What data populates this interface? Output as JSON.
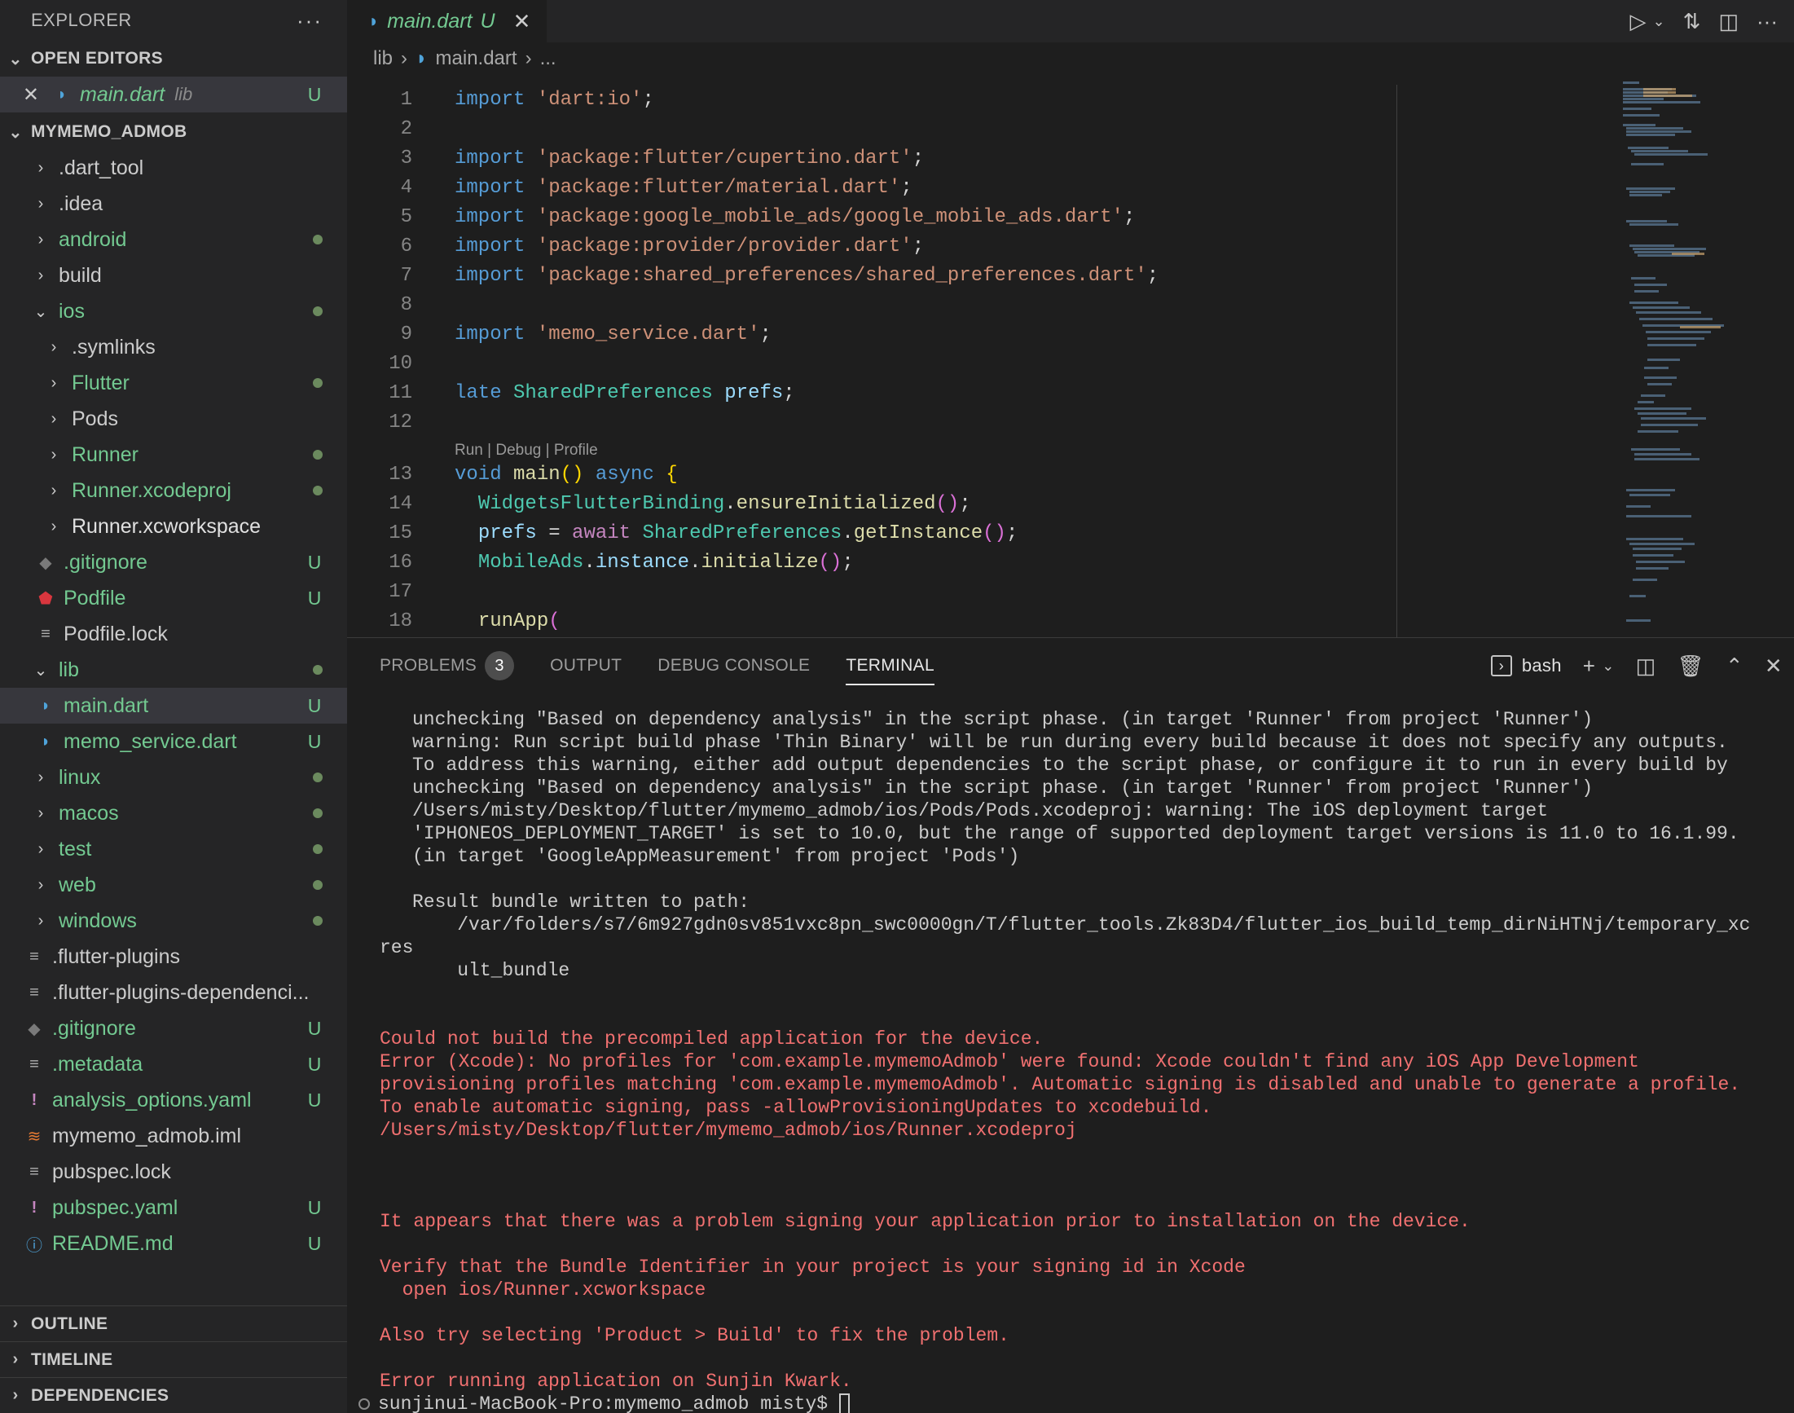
{
  "sidebar": {
    "title": "EXPLORER",
    "open_editors": {
      "label": "OPEN EDITORS",
      "items": [
        {
          "name": "main.dart",
          "folder": "lib",
          "badge": "U"
        }
      ]
    },
    "project": {
      "label": "MYMEMO_ADMOB",
      "items": [
        {
          "label": ".dart_tool"
        },
        {
          "label": ".idea"
        },
        {
          "label": "android"
        },
        {
          "label": "build"
        },
        {
          "label": "ios"
        },
        {
          "label": ".symlinks"
        },
        {
          "label": "Flutter"
        },
        {
          "label": "Pods"
        },
        {
          "label": "Runner"
        },
        {
          "label": "Runner.xcodeproj"
        },
        {
          "label": "Runner.xcworkspace"
        },
        {
          "label": ".gitignore",
          "badge": "U"
        },
        {
          "label": "Podfile",
          "badge": "U"
        },
        {
          "label": "Podfile.lock"
        },
        {
          "label": "lib"
        },
        {
          "label": "main.dart",
          "badge": "U"
        },
        {
          "label": "memo_service.dart",
          "badge": "U"
        },
        {
          "label": "linux"
        },
        {
          "label": "macos"
        },
        {
          "label": "test"
        },
        {
          "label": "web"
        },
        {
          "label": "windows"
        },
        {
          "label": ".flutter-plugins"
        },
        {
          "label": ".flutter-plugins-dependenci..."
        },
        {
          "label": ".gitignore",
          "badge": "U"
        },
        {
          "label": ".metadata",
          "badge": "U"
        },
        {
          "label": "analysis_options.yaml",
          "badge": "U"
        },
        {
          "label": "mymemo_admob.iml"
        },
        {
          "label": "pubspec.lock"
        },
        {
          "label": "pubspec.yaml",
          "badge": "U"
        },
        {
          "label": "README.md",
          "badge": "U"
        }
      ]
    },
    "outline": "OUTLINE",
    "timeline": "TIMELINE",
    "dependencies": "DEPENDENCIES"
  },
  "editor": {
    "tab": {
      "name": "main.dart",
      "badge": "U"
    },
    "breadcrumb": {
      "folder": "lib",
      "file": "main.dart",
      "more": "..."
    },
    "codelens": "Run | Debug | Profile",
    "line_numbers": [
      "1",
      "2",
      "3",
      "4",
      "5",
      "6",
      "7",
      "8",
      "9",
      "10",
      "11",
      "12",
      "13",
      "14",
      "15",
      "16",
      "17",
      "18"
    ],
    "code": {
      "l1": "'dart:io'",
      "l3": "'package:flutter/cupertino.dart'",
      "l4": "'package:flutter/material.dart'",
      "l5": "'package:google_mobile_ads/google_mobile_ads.dart'",
      "l6": "'package:provider/provider.dart'",
      "l7": "'package:shared_preferences/shared_preferences.dart'",
      "l9": "'memo_service.dart'",
      "l11_type": "SharedPreferences",
      "l11_var": "prefs",
      "l13_fn": "main",
      "l14_type": "WidgetsFlutterBinding",
      "l14_fn": "ensureInitialized",
      "l15_var": "prefs",
      "l15_type": "SharedPreferences",
      "l15_fn": "getInstance",
      "l16_type": "MobileAds",
      "l16_var": "instance",
      "l16_fn": "initialize",
      "l18_fn": "runApp"
    }
  },
  "panel": {
    "tabs": {
      "problems": "PROBLEMS",
      "problems_count": "3",
      "output": "OUTPUT",
      "debug_console": "DEBUG CONSOLE",
      "terminal": "TERMINAL"
    },
    "shell": "bash",
    "terminal_lines": [
      {
        "text": "unchecking \"Based on dependency analysis\" in the script phase. (in target 'Runner' from project 'Runner')",
        "err": false
      },
      {
        "text": "warning: Run script build phase 'Thin Binary' will be run during every build because it does not specify any outputs.",
        "err": false
      },
      {
        "text": "To address this warning, either add output dependencies to the script phase, or configure it to run in every build by",
        "err": false
      },
      {
        "text": "unchecking \"Based on dependency analysis\" in the script phase. (in target 'Runner' from project 'Runner')",
        "err": false
      },
      {
        "text": "/Users/misty/Desktop/flutter/mymemo_admob/ios/Pods/Pods.xcodeproj: warning: The iOS deployment target",
        "err": false
      },
      {
        "text": "'IPHONEOS_DEPLOYMENT_TARGET' is set to 10.0, but the range of supported deployment target versions is 11.0 to 16.1.99.",
        "err": false
      },
      {
        "text": "(in target 'GoogleAppMeasurement' from project 'Pods')",
        "err": false
      },
      {
        "text": "",
        "err": false
      },
      {
        "text": "Result bundle written to path:",
        "err": false
      },
      {
        "text": "    /var/folders/s7/6m927gdn0sv851vxc8pn_swc0000gn/T/flutter_tools.Zk83D4/flutter_ios_build_temp_dirNiHTNj/temporary_xc",
        "err": false
      },
      {
        "text": "res",
        "err": false,
        "outdent": true
      },
      {
        "text": "    ult_bundle",
        "err": false
      },
      {
        "text": "",
        "err": false
      },
      {
        "text": "",
        "err": false
      },
      {
        "text": "Could not build the precompiled application for the device.",
        "err": true,
        "outdent": true
      },
      {
        "text": "Error (Xcode): No profiles for 'com.example.mymemoAdmob' were found: Xcode couldn't find any iOS App Development",
        "err": true,
        "outdent": true
      },
      {
        "text": "provisioning profiles matching 'com.example.mymemoAdmob'. Automatic signing is disabled and unable to generate a profile.",
        "err": true,
        "outdent": true
      },
      {
        "text": "To enable automatic signing, pass -allowProvisioningUpdates to xcodebuild.",
        "err": true,
        "outdent": true
      },
      {
        "text": "/Users/misty/Desktop/flutter/mymemo_admob/ios/Runner.xcodeproj",
        "err": true,
        "outdent": true
      },
      {
        "text": "",
        "err": false
      },
      {
        "text": "",
        "err": false
      },
      {
        "text": "",
        "err": false
      },
      {
        "text": "It appears that there was a problem signing your application prior to installation on the device.",
        "err": true,
        "outdent": true
      },
      {
        "text": "",
        "err": false
      },
      {
        "text": "Verify that the Bundle Identifier in your project is your signing id in Xcode",
        "err": true,
        "outdent": true
      },
      {
        "text": "  open ios/Runner.xcworkspace",
        "err": true,
        "outdent": true
      },
      {
        "text": "",
        "err": false
      },
      {
        "text": "Also try selecting 'Product > Build' to fix the problem.",
        "err": true,
        "outdent": true
      },
      {
        "text": "",
        "err": false
      },
      {
        "text": "Error running application on Sunjin Kwark.",
        "err": true,
        "outdent": true
      }
    ],
    "prompt": "sunjinui-MacBook-Pro:mymemo_admob misty$ "
  }
}
